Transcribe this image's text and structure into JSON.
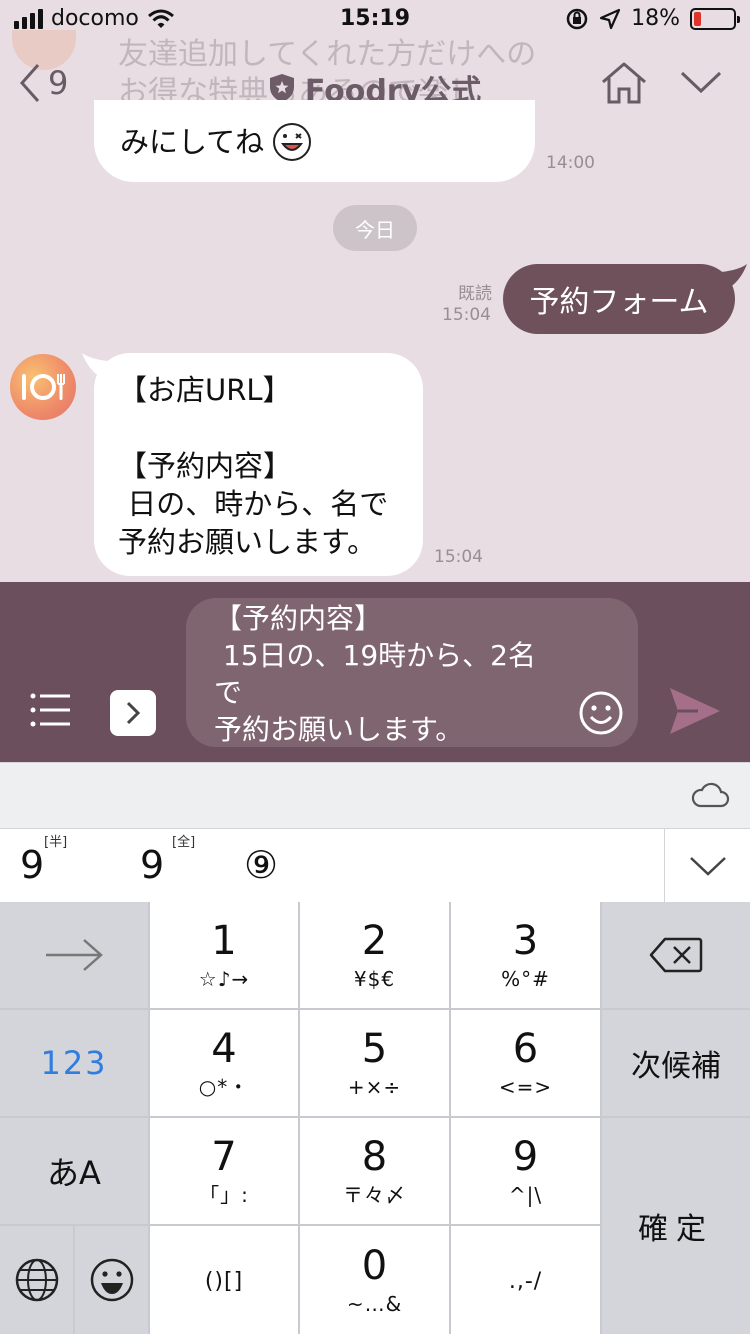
{
  "status": {
    "carrier": "docomo",
    "time": "15:19",
    "battery": "18%",
    "battery_level": 0.18
  },
  "background_notice": "友達追加してくれた方だけへのお得な特典もあるので楽し",
  "nav": {
    "back_count": "9",
    "title": "Foodry公式"
  },
  "messages": [
    {
      "from": "bot",
      "text": "みにしてね",
      "time": "14:00"
    },
    {
      "type": "date",
      "label": "今日"
    },
    {
      "from": "me",
      "text": "予約フォーム",
      "read": "既読",
      "time": "15:04"
    },
    {
      "from": "bot",
      "lines": [
        "【お店URL】",
        "",
        "【予約内容】",
        " 日の、時から、名で",
        "予約お願いします。"
      ],
      "time": "15:04"
    }
  ],
  "input": {
    "lines": [
      "【予約内容】",
      " 15日の、19時から、2名",
      "で",
      "予約お願いします。"
    ]
  },
  "candidates": [
    {
      "text": "9",
      "tag": "[半]"
    },
    {
      "text": "9",
      "tag": "[全]"
    },
    {
      "text": "⑨",
      "tag": ""
    }
  ],
  "keyboard": {
    "keys": [
      {
        "main": "1",
        "sub": "☆♪→"
      },
      {
        "main": "2",
        "sub": "¥$€"
      },
      {
        "main": "3",
        "sub": "%°#"
      },
      {
        "main": "4",
        "sub": "○*・"
      },
      {
        "main": "5",
        "sub": "+×÷"
      },
      {
        "main": "6",
        "sub": "<=>"
      },
      {
        "main": "7",
        "sub": "「」:"
      },
      {
        "main": "8",
        "sub": "〒々〆"
      },
      {
        "main": "9",
        "sub": "^|\\"
      },
      {
        "main": "()[]",
        "sub": ""
      },
      {
        "main": "0",
        "sub": "~…&"
      },
      {
        "main": ".,-/",
        "sub": ""
      }
    ],
    "left": {
      "mode_123": "123",
      "mode_kana": "あA"
    },
    "right": {
      "next_candidate": "次候補",
      "confirm": "確定"
    }
  },
  "colors": {
    "accent": "#6b4f5c",
    "sent_bubble": "#6f515c",
    "background": "#e7dde2"
  }
}
